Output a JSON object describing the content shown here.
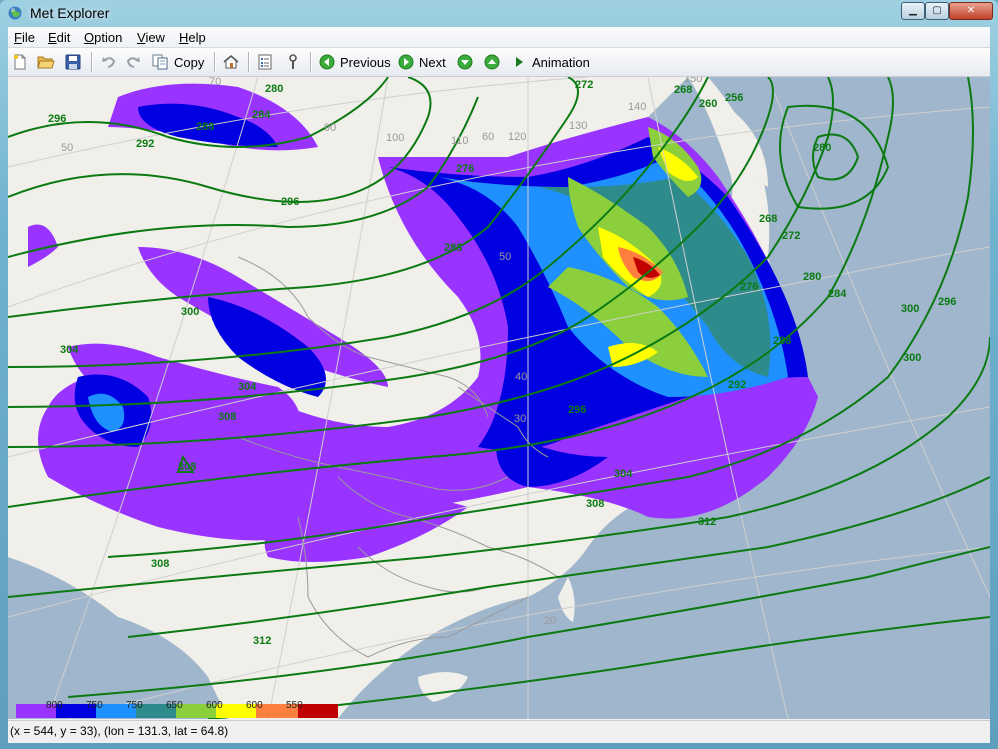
{
  "window": {
    "title": "Met Explorer",
    "min_glyph": "▁",
    "max_glyph": "▢",
    "close_glyph": "✕"
  },
  "menu": [
    {
      "label": "File",
      "key": "F",
      "rest": "ile"
    },
    {
      "label": "Edit",
      "key": "E",
      "rest": "dit"
    },
    {
      "label": "Option",
      "key": "O",
      "rest": "ption"
    },
    {
      "label": "View",
      "key": "V",
      "rest": "iew"
    },
    {
      "label": "Help",
      "key": "H",
      "rest": "elp"
    }
  ],
  "toolbar": {
    "copy": "Copy",
    "previous": "Previous",
    "next": "Next",
    "animation": "Animation"
  },
  "map": {
    "colors": {
      "land": "#f1efe9",
      "sea": "#9fb6cc",
      "contour": "#0b7a12",
      "shade_purple": "#9933ff",
      "shade_blue": "#0000e0",
      "shade_skyblue": "#1e90ff",
      "shade_teal": "#2e8b8b",
      "shade_green": "#8ccf3c",
      "shade_yellow": "#ffff00",
      "shade_orange": "#ff7f3f",
      "shade_red": "#c00000"
    },
    "contour_labels": [
      "296",
      "292",
      "280",
      "288",
      "284",
      "296",
      "300",
      "304",
      "308",
      "308",
      "308",
      "312",
      "312",
      "304",
      "300",
      "296",
      "284",
      "280",
      "272",
      "268",
      "276",
      "288",
      "292",
      "296",
      "268",
      "256",
      "260",
      "272",
      "276",
      "280",
      "288",
      "300",
      "304",
      "308"
    ],
    "grid_labels": [
      "50",
      "70",
      "90",
      "100",
      "110",
      "60",
      "120",
      "130",
      "140",
      "150",
      "40",
      "50",
      "30",
      "20"
    ],
    "legend": {
      "labels": [
        "800",
        "750",
        "750",
        "650",
        "600",
        "600",
        "550"
      ],
      "colors": [
        "#9933ff",
        "#0000e0",
        "#1e90ff",
        "#2e8b8b",
        "#8ccf3c",
        "#ffff00",
        "#ff7f3f",
        "#c00000"
      ]
    }
  },
  "status": {
    "text": "(x = 544, y = 33), (lon = 131.3, lat = 64.8)"
  }
}
